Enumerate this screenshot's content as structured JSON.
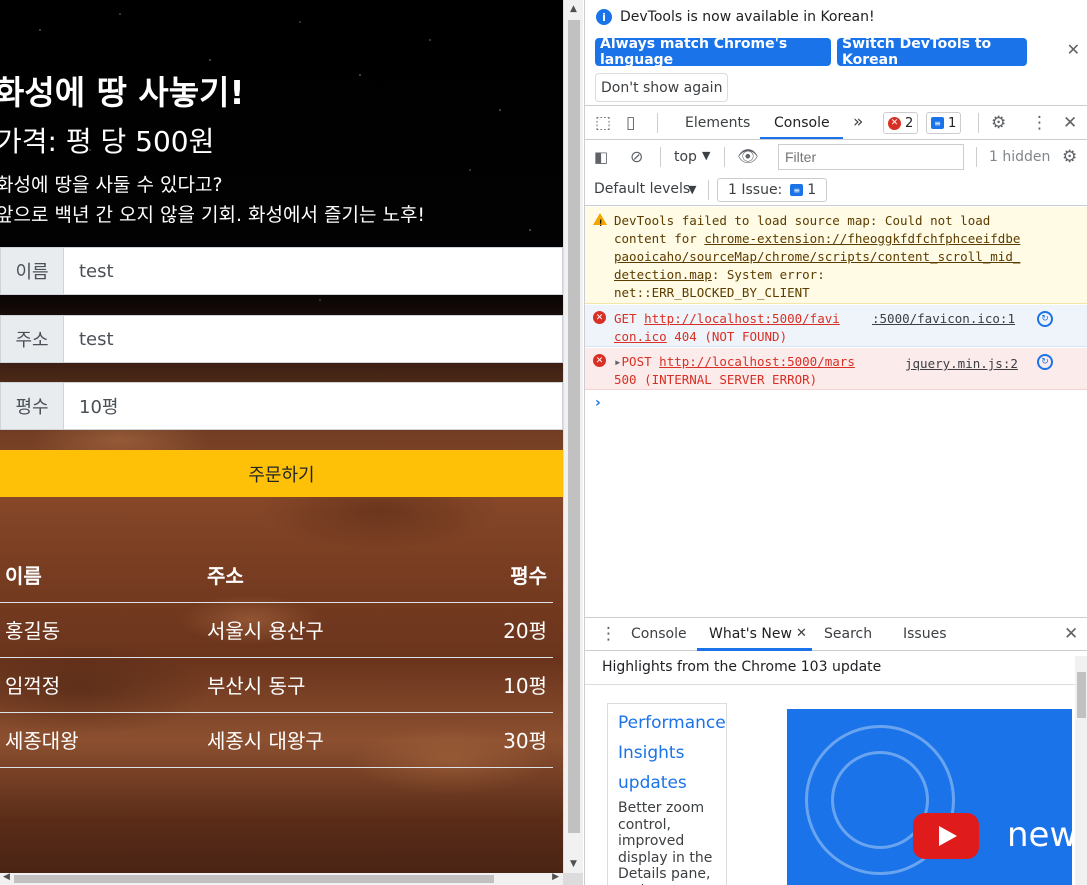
{
  "page": {
    "title": "화성에 땅 사놓기!",
    "price": "가격: 평 당 500원",
    "desc_line1": "화성에 땅을 사둘 수 있다고?",
    "desc_line2": "앞으로 백년 간 오지 않을 기회. 화성에서 즐기는 노후!",
    "form": {
      "name_label": "이름",
      "name_value": "test",
      "address_label": "주소",
      "address_value": "test",
      "size_label": "평수",
      "size_value": "10평"
    },
    "order_button": "주문하기",
    "table": {
      "headers": [
        "이름",
        "주소",
        "평수"
      ],
      "rows": [
        [
          "홍길동",
          "서울시 용산구",
          "20평"
        ],
        [
          "임꺽정",
          "부산시 동구",
          "10평"
        ],
        [
          "세종대왕",
          "세종시 대왕구",
          "30평"
        ]
      ]
    }
  },
  "devtools": {
    "infobar": {
      "message": "DevTools is now available in Korean!",
      "btn_match": "Always match Chrome's language",
      "btn_switch": "Switch DevTools to Korean",
      "btn_dismiss": "Don't show again"
    },
    "tabs": {
      "elements": "Elements",
      "console": "Console",
      "more": "»",
      "error_count": "2",
      "issue_count": "1"
    },
    "console_toolbar": {
      "context": "top",
      "filter_placeholder": "Filter",
      "hidden": "1 hidden",
      "levels": "Default levels",
      "issues": "1 Issue:",
      "issues_count": "1"
    },
    "messages": {
      "warn_text": "DevTools failed to load source map: Could not load\ncontent for ",
      "warn_link": "chrome-extension://fheoggkfdfchfphceeifdbe\npaooicaho/sourceMap/chrome/scripts/content_scroll_mid_\ndetection.map",
      "warn_tail": ": System error:\nnet::ERR_BLOCKED_BY_CLIENT",
      "err1_method": "GET ",
      "err1_url": "http://localhost:5000/favi\ncon.ico",
      "err1_status": " 404 (NOT FOUND)",
      "err1_src": ":5000/favicon.ico:1",
      "err2_method": "POST ",
      "err2_url": "http://localhost:5000/mars",
      "err2_status": "500 (INTERNAL SERVER ERROR)",
      "err2_src": "jquery.min.js:2",
      "prompt": "›"
    },
    "drawer": {
      "tabs": [
        "Console",
        "What's New",
        "Search",
        "Issues"
      ],
      "highlights": "Highlights from the Chrome 103 update",
      "card_title": "Performance Insights updates",
      "card_desc": "Better zoom control, improved display in the Details pane, and more.",
      "video_text": "new"
    }
  },
  "colors": {
    "accent": "#1a73e8",
    "order_button": "#ffc107",
    "error": "#d93025",
    "warning": "#f2a600"
  }
}
